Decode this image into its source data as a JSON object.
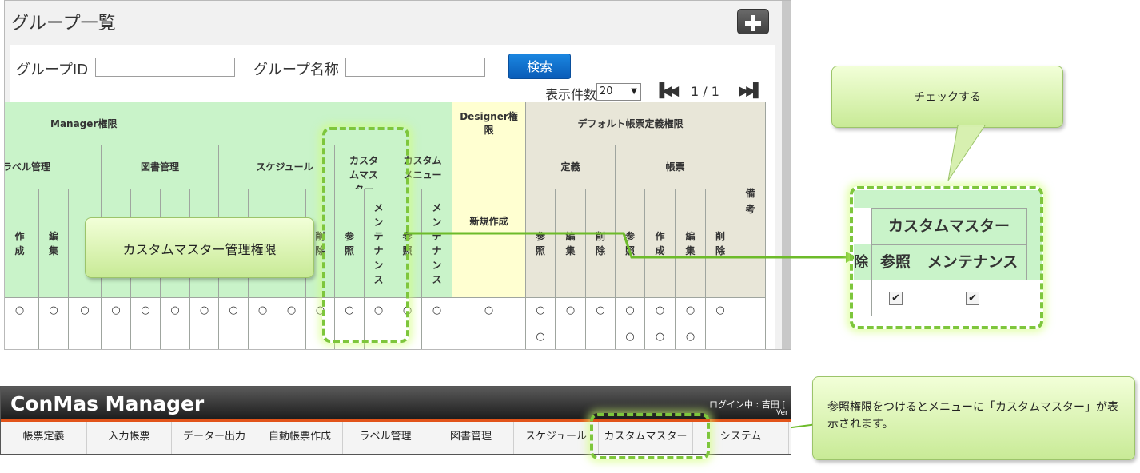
{
  "group_list": {
    "title": "グループ一覧",
    "group_id_label": "グループID",
    "group_id_value": "",
    "group_name_label": "グループ名称",
    "group_name_value": "",
    "search_label": "検索",
    "page_size_label": "表示件数",
    "page_size_value": "20",
    "page_indicator": "1 / 1",
    "header": {
      "manager": "Manager権限",
      "designer": "Designer権限",
      "default_form": "デフォルト帳票定義権限",
      "remarks": "備考",
      "label_mgmt": "ラベル管理",
      "library_mgmt": "図書管理",
      "schedule": "スケジュール",
      "custom_master": "カスタムマスター",
      "custom_menu": "カスタムメニュー",
      "new_create": "新規作成",
      "definition": "定義",
      "forms": "帳票",
      "create": "作成",
      "edit": "編集",
      "delete": "削除",
      "view": "参照",
      "maintenance": "メンテナンス"
    },
    "row1_symbol": "○",
    "row2_symbol": "○"
  },
  "callouts": {
    "custom_master_permission": "カスタムマスター管理権限",
    "check_it": "チェックする",
    "menu_note": "参照権限をつけるとメニューに「カスタムマスター」が表示されます。"
  },
  "zoom": {
    "header": "カスタムマスター",
    "view": "参照",
    "maintenance": "メンテナンス",
    "view_checked": true,
    "maintenance_checked": true,
    "left_fragment": "除"
  },
  "manager_bar": {
    "title": "ConMas Manager",
    "login": "ログイン中 : 吉田 [",
    "version": "Ver",
    "menu": [
      "帳票定義",
      "入力帳票",
      "データー出力",
      "自動帳票作成",
      "ラベル管理",
      "図書管理",
      "スケジュール",
      "カスタムマスター",
      "システム"
    ]
  },
  "colors": {
    "manager_header": "#c9f3c9",
    "designer_header": "#ffffd1",
    "default_header": "#e8e6d8",
    "search_button": "#0a5cb8",
    "highlight_dash": "#7ec63c",
    "accent_stripe": "#e2541a"
  },
  "icons": [
    "plus-icon",
    "page-first-icon",
    "page-last-icon",
    "checkbox-icon"
  ]
}
